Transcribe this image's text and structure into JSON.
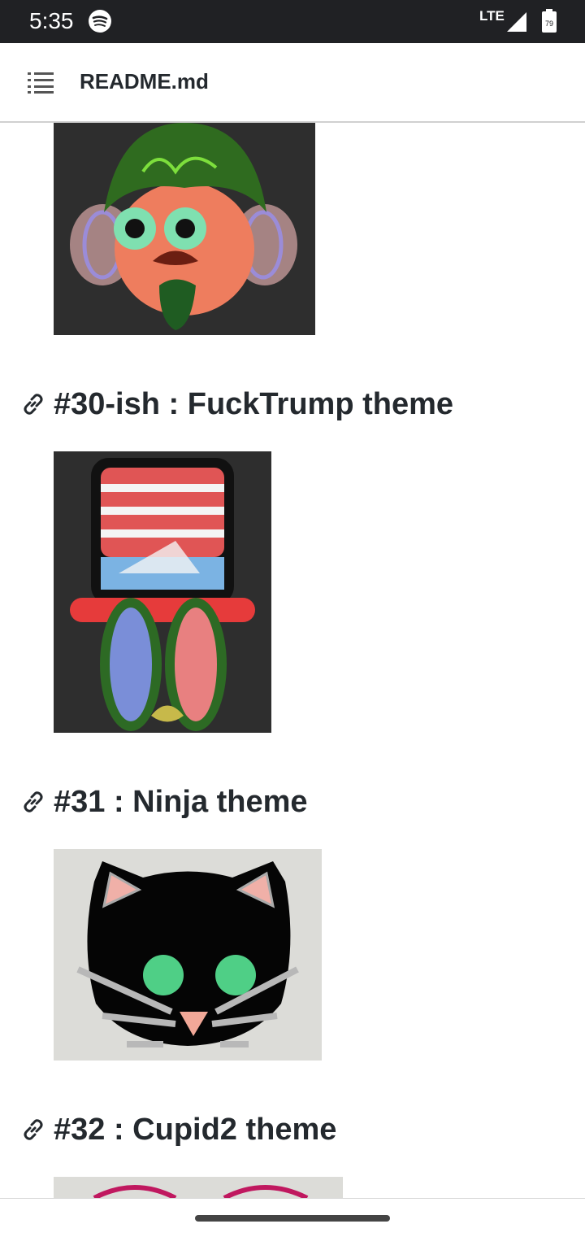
{
  "status_bar": {
    "time": "5:35",
    "network": "LTE",
    "battery_level": "79",
    "icons": [
      "spotify-icon",
      "signal-icon",
      "battery-icon"
    ]
  },
  "header": {
    "title": "README.md",
    "menu_icon": "list-menu-icon"
  },
  "sections": [
    {
      "heading": "#30-ish : FuckTrump theme",
      "icon": "link-icon"
    },
    {
      "heading": "#31 : Ninja theme",
      "icon": "link-icon"
    },
    {
      "heading": "#32 : Cupid2 theme",
      "icon": "link-icon"
    }
  ],
  "colors": {
    "status_bar_bg": "#202124",
    "text": "#24292e",
    "image_dark_bg": "#2e2e2e",
    "image_light_bg": "#dcdcd8"
  }
}
